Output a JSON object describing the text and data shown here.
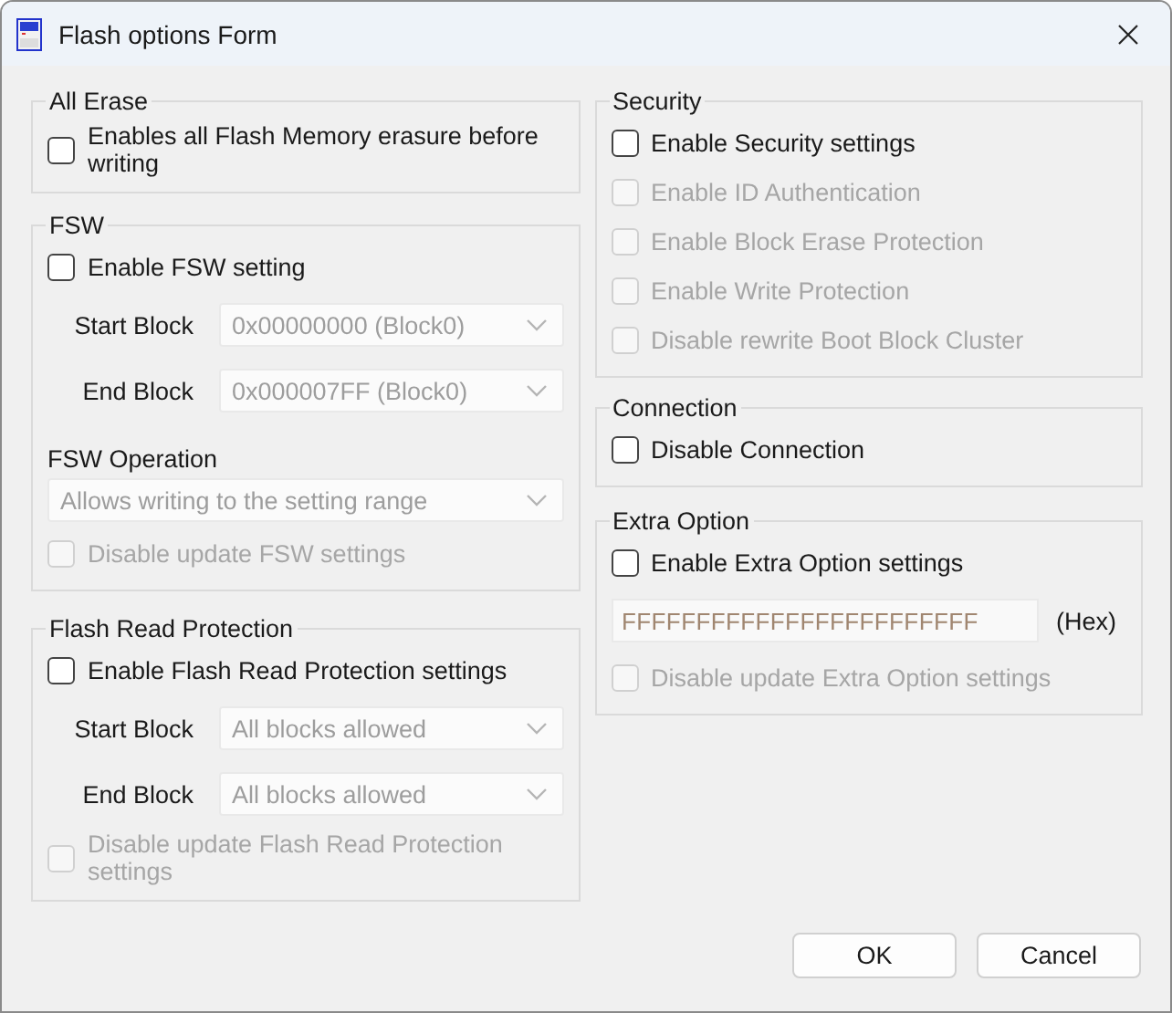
{
  "window": {
    "title": "Flash options Form"
  },
  "left_column": [
    {
      "title": "All Erase",
      "items": [
        {
          "kind": "checkbox",
          "label": "Enables all Flash Memory erasure before writing",
          "checked": false,
          "disabled": false
        }
      ]
    },
    {
      "title": "FSW",
      "items": [
        {
          "kind": "checkbox",
          "label": "Enable FSW setting",
          "checked": false,
          "disabled": false
        },
        {
          "kind": "combo",
          "label": "Start Block",
          "value": "0x00000000 (Block0)",
          "disabled": true
        },
        {
          "kind": "combo",
          "label": "End Block",
          "value": "0x000007FF (Block0)",
          "disabled": true
        },
        {
          "kind": "caption",
          "label": "FSW Operation"
        },
        {
          "kind": "combo-wide",
          "value": "Allows writing to the setting range",
          "disabled": true
        },
        {
          "kind": "checkbox",
          "label": "Disable update FSW settings",
          "checked": false,
          "disabled": true
        }
      ]
    },
    {
      "title": "Flash Read Protection",
      "items": [
        {
          "kind": "checkbox",
          "label": "Enable Flash Read Protection settings",
          "checked": false,
          "disabled": false
        },
        {
          "kind": "combo",
          "label": "Start Block",
          "value": "All blocks allowed",
          "disabled": true
        },
        {
          "kind": "combo",
          "label": "End Block",
          "value": "All blocks allowed",
          "disabled": true
        },
        {
          "kind": "checkbox",
          "label": "Disable update Flash Read Protection settings",
          "checked": false,
          "disabled": true
        }
      ]
    }
  ],
  "right_column": [
    {
      "title": "Security",
      "items": [
        {
          "kind": "checkbox",
          "label": "Enable Security settings",
          "checked": false,
          "disabled": false
        },
        {
          "kind": "checkbox",
          "label": "Enable ID Authentication",
          "checked": false,
          "disabled": true
        },
        {
          "kind": "checkbox",
          "label": "Enable Block Erase Protection",
          "checked": false,
          "disabled": true
        },
        {
          "kind": "checkbox",
          "label": "Enable Write Protection",
          "checked": false,
          "disabled": true
        },
        {
          "kind": "checkbox",
          "label": "Disable rewrite Boot Block Cluster",
          "checked": false,
          "disabled": true
        }
      ]
    },
    {
      "title": "Connection",
      "items": [
        {
          "kind": "checkbox",
          "label": "Disable Connection",
          "checked": false,
          "disabled": false
        }
      ]
    },
    {
      "title": "Extra Option",
      "items": [
        {
          "kind": "checkbox",
          "label": "Enable Extra Option settings",
          "checked": false,
          "disabled": false
        },
        {
          "kind": "hex",
          "value": "FFFFFFFFFFFFFFFFFFFFFFFF",
          "unit": "(Hex)",
          "disabled": true
        },
        {
          "kind": "checkbox",
          "label": "Disable update Extra Option settings",
          "checked": false,
          "disabled": true
        }
      ]
    }
  ],
  "buttons": [
    "OK",
    "Cancel"
  ]
}
